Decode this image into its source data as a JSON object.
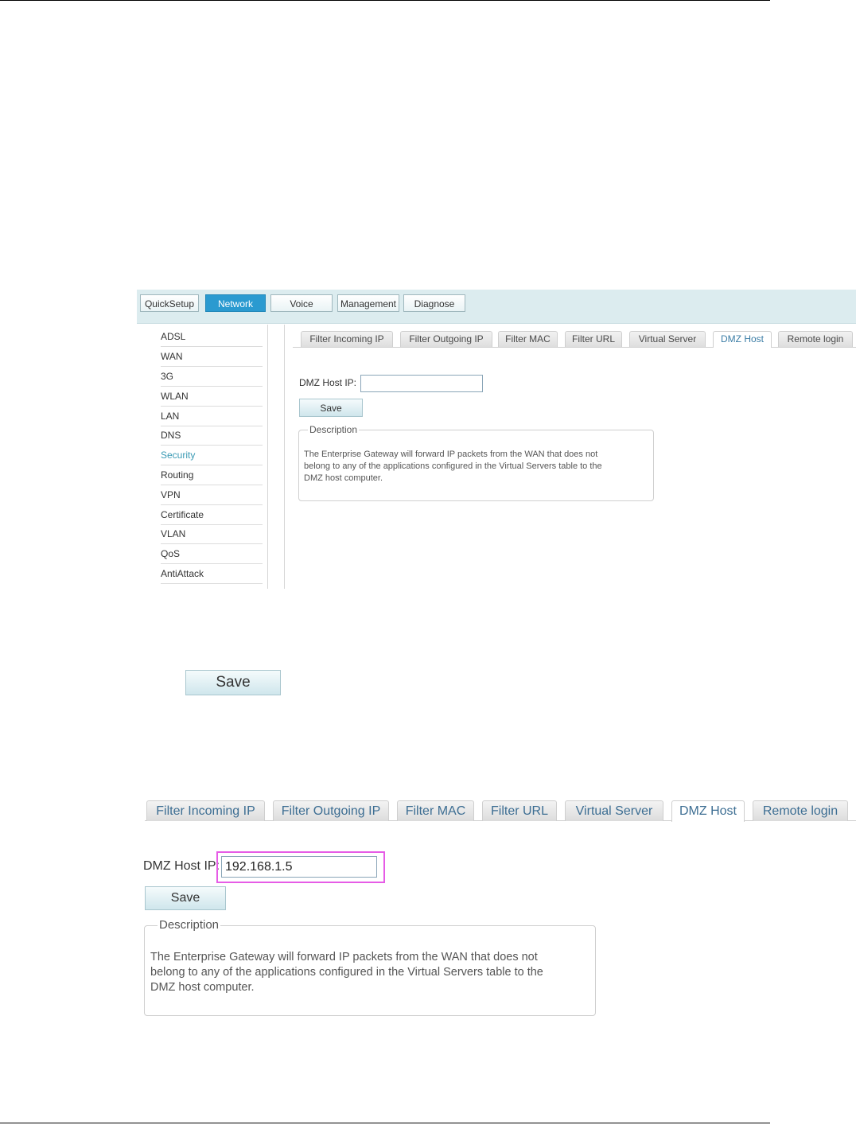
{
  "top_nav": [
    "QuickSetup",
    "Network",
    "Voice",
    "Management",
    "Diagnose"
  ],
  "sidebar": [
    "ADSL",
    "WAN",
    "3G",
    "WLAN",
    "LAN",
    "DNS",
    "Security",
    "Routing",
    "VPN",
    "Certificate",
    "VLAN",
    "QoS",
    "AntiAttack"
  ],
  "tabs": [
    "Filter Incoming IP",
    "Filter Outgoing IP",
    "Filter MAC",
    "Filter URL",
    "Virtual Server",
    "DMZ Host",
    "Remote login"
  ],
  "form": {
    "label": "DMZ Host IP:",
    "value_empty": "",
    "value_filled": "192.168.1.5",
    "save": "Save"
  },
  "description": {
    "legend": "Description",
    "line1": "The Enterprise Gateway will forward IP packets from the WAN that does not",
    "line2": "belong to any of the applications configured in the Virtual Servers table to the",
    "line3": "DMZ host computer."
  },
  "standalone_button": "Save",
  "colors": {
    "accent": "#2a9ad0",
    "highlight": "#e65ce6",
    "active_menu": "#3a9ab4"
  }
}
